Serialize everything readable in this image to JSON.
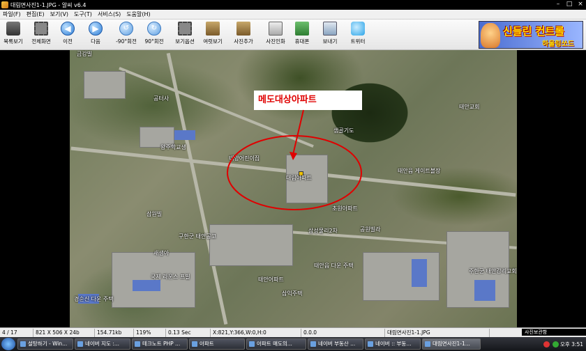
{
  "window": {
    "title": "대림면사진1-1.JPG - 알씨 v6.4",
    "minimize": "–",
    "maximize": "□",
    "close": "×"
  },
  "menu": [
    "파일(F)",
    "편집(E)",
    "보기(V)",
    "도구(T)",
    "서비스(S)",
    "도움말(H)"
  ],
  "toolbar": [
    {
      "label": "목록보기",
      "icon": "grid-list-icon"
    },
    {
      "label": "전체화면",
      "icon": "fullscreen-icon"
    },
    {
      "label": "이전",
      "icon": "prev-icon",
      "glyph": "◀"
    },
    {
      "label": "다음",
      "icon": "next-icon",
      "glyph": "▶"
    },
    {
      "label": "-90°회전",
      "icon": "rotate-left-icon",
      "glyph": "↺"
    },
    {
      "label": "90°회전",
      "icon": "rotate-right-icon",
      "glyph": "↻"
    },
    {
      "label": "보기옵션",
      "icon": "view-options-icon"
    },
    {
      "label": "여럿보기",
      "icon": "multi-view-icon"
    },
    {
      "label": "사진추가",
      "icon": "add-photo-icon"
    },
    {
      "label": "사진인화",
      "icon": "print-photo-icon"
    },
    {
      "label": "휴대폰",
      "icon": "mobile-phone-icon"
    },
    {
      "label": "보내기",
      "icon": "send-icon"
    },
    {
      "label": "트위터",
      "icon": "twitter-icon"
    }
  ],
  "banner": {
    "line1": "신들린 컨트롤",
    "line2": "하울링쏘드"
  },
  "map": {
    "callout": "메도대상아파트",
    "labels": [
      "태양어린이집",
      "대림아파트",
      "샘골기도",
      "태안교회",
      "공터사",
      "왕주학교생",
      "삼원빌",
      "태안읍 게이트볼장",
      "초원아파트",
      "삼성물리2차",
      "공원빌라",
      "구한군 태안공고",
      "태안읍 다운 주택",
      "국제 라운스 프빌",
      "경순신 다운 주택",
      "새생아",
      "주한군 태안감리교회",
      "삼익주택",
      "태안어파트",
      "금강빌"
    ]
  },
  "status": {
    "position": "4 / 17",
    "dimensions": "821 X 506 X 24b",
    "filesize": "154.71kb",
    "zoom": "119%",
    "time": "0.13 Sec",
    "coords": "X:821,Y:366,W:0,H:0",
    "value": "0.0.0",
    "filename": "대림면사진1-1.JPG",
    "tooltip": "사진보관함"
  },
  "taskbar": {
    "tasks": [
      "설탕하기 - Win...",
      "네이버 지도 :...",
      "테크노트 PHP ...",
      "아파트",
      "아파트 매도의...",
      "네이버 부동산 ...",
      "네이버 :: 부동...",
      "대림면사진1-1..."
    ],
    "clock": "오후 3:51"
  }
}
